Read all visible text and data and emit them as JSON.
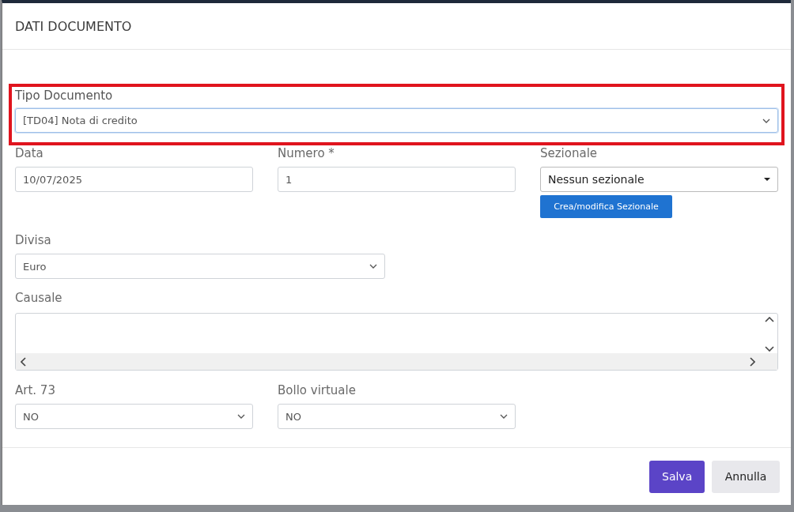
{
  "dialog": {
    "title": "DATI DOCUMENTO"
  },
  "rows": [
    {
      "fields": [
        {
          "kind": "select",
          "label": "Tipo Documento",
          "value": "[TD04] Nota di credito",
          "highlighted": true
        }
      ]
    },
    {
      "fields": [
        {
          "kind": "input",
          "label": "Data",
          "value": "10/07/2025"
        },
        {
          "kind": "input",
          "label": "Numero *",
          "value": "1"
        },
        {
          "kind": "dropdown",
          "label": "Sezionale",
          "value": "Nessun sezionale",
          "action": "Crea/modifica Sezionale"
        }
      ]
    },
    {
      "fields": [
        {
          "kind": "select",
          "label": "Divisa",
          "value": "Euro"
        }
      ]
    },
    {
      "fields": [
        {
          "kind": "textarea",
          "label": "Causale"
        }
      ]
    },
    {
      "fields": [
        {
          "kind": "select",
          "label": "Art. 73",
          "value": "NO"
        },
        {
          "kind": "select",
          "label": "Bollo virtuale",
          "value": "NO"
        }
      ]
    }
  ],
  "buttons": [
    {
      "kind": "primary",
      "label": "Salva"
    },
    {
      "kind": "secondary",
      "label": "Annulla"
    }
  ]
}
